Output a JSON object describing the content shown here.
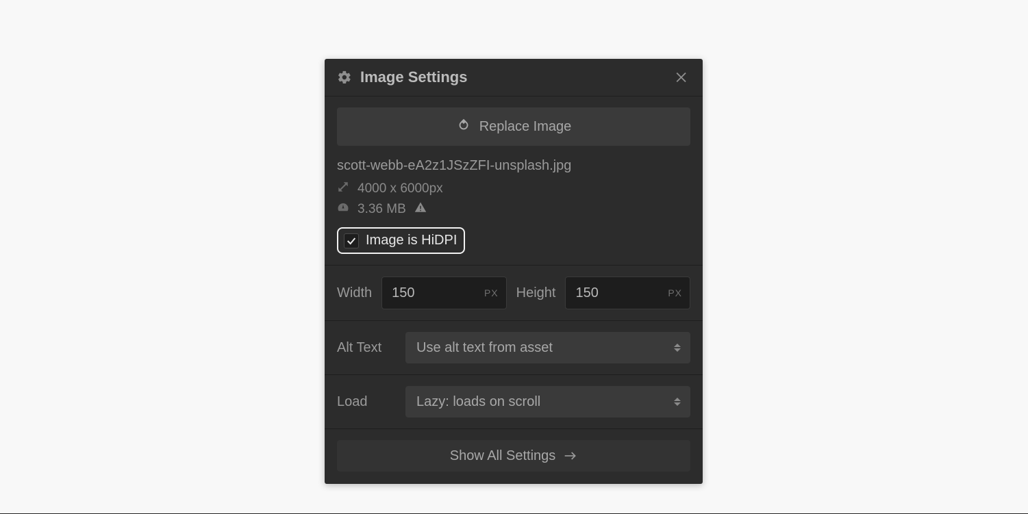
{
  "panel": {
    "title": "Image Settings",
    "replace_label": "Replace Image",
    "filename": "scott-webb-eA2z1JSzZFI-unsplash.jpg",
    "dimensions_text": "4000 x 6000px",
    "filesize_text": "3.36 MB",
    "hidpi_checked": true,
    "hidpi_label": "Image is HiDPI",
    "width_label": "Width",
    "width_value": "150",
    "width_unit": "PX",
    "height_label": "Height",
    "height_value": "150",
    "height_unit": "PX",
    "alt_label": "Alt Text",
    "alt_selected": "Use alt text from asset",
    "load_label": "Load",
    "load_selected": "Lazy: loads on scroll",
    "show_all_label": "Show All Settings"
  }
}
